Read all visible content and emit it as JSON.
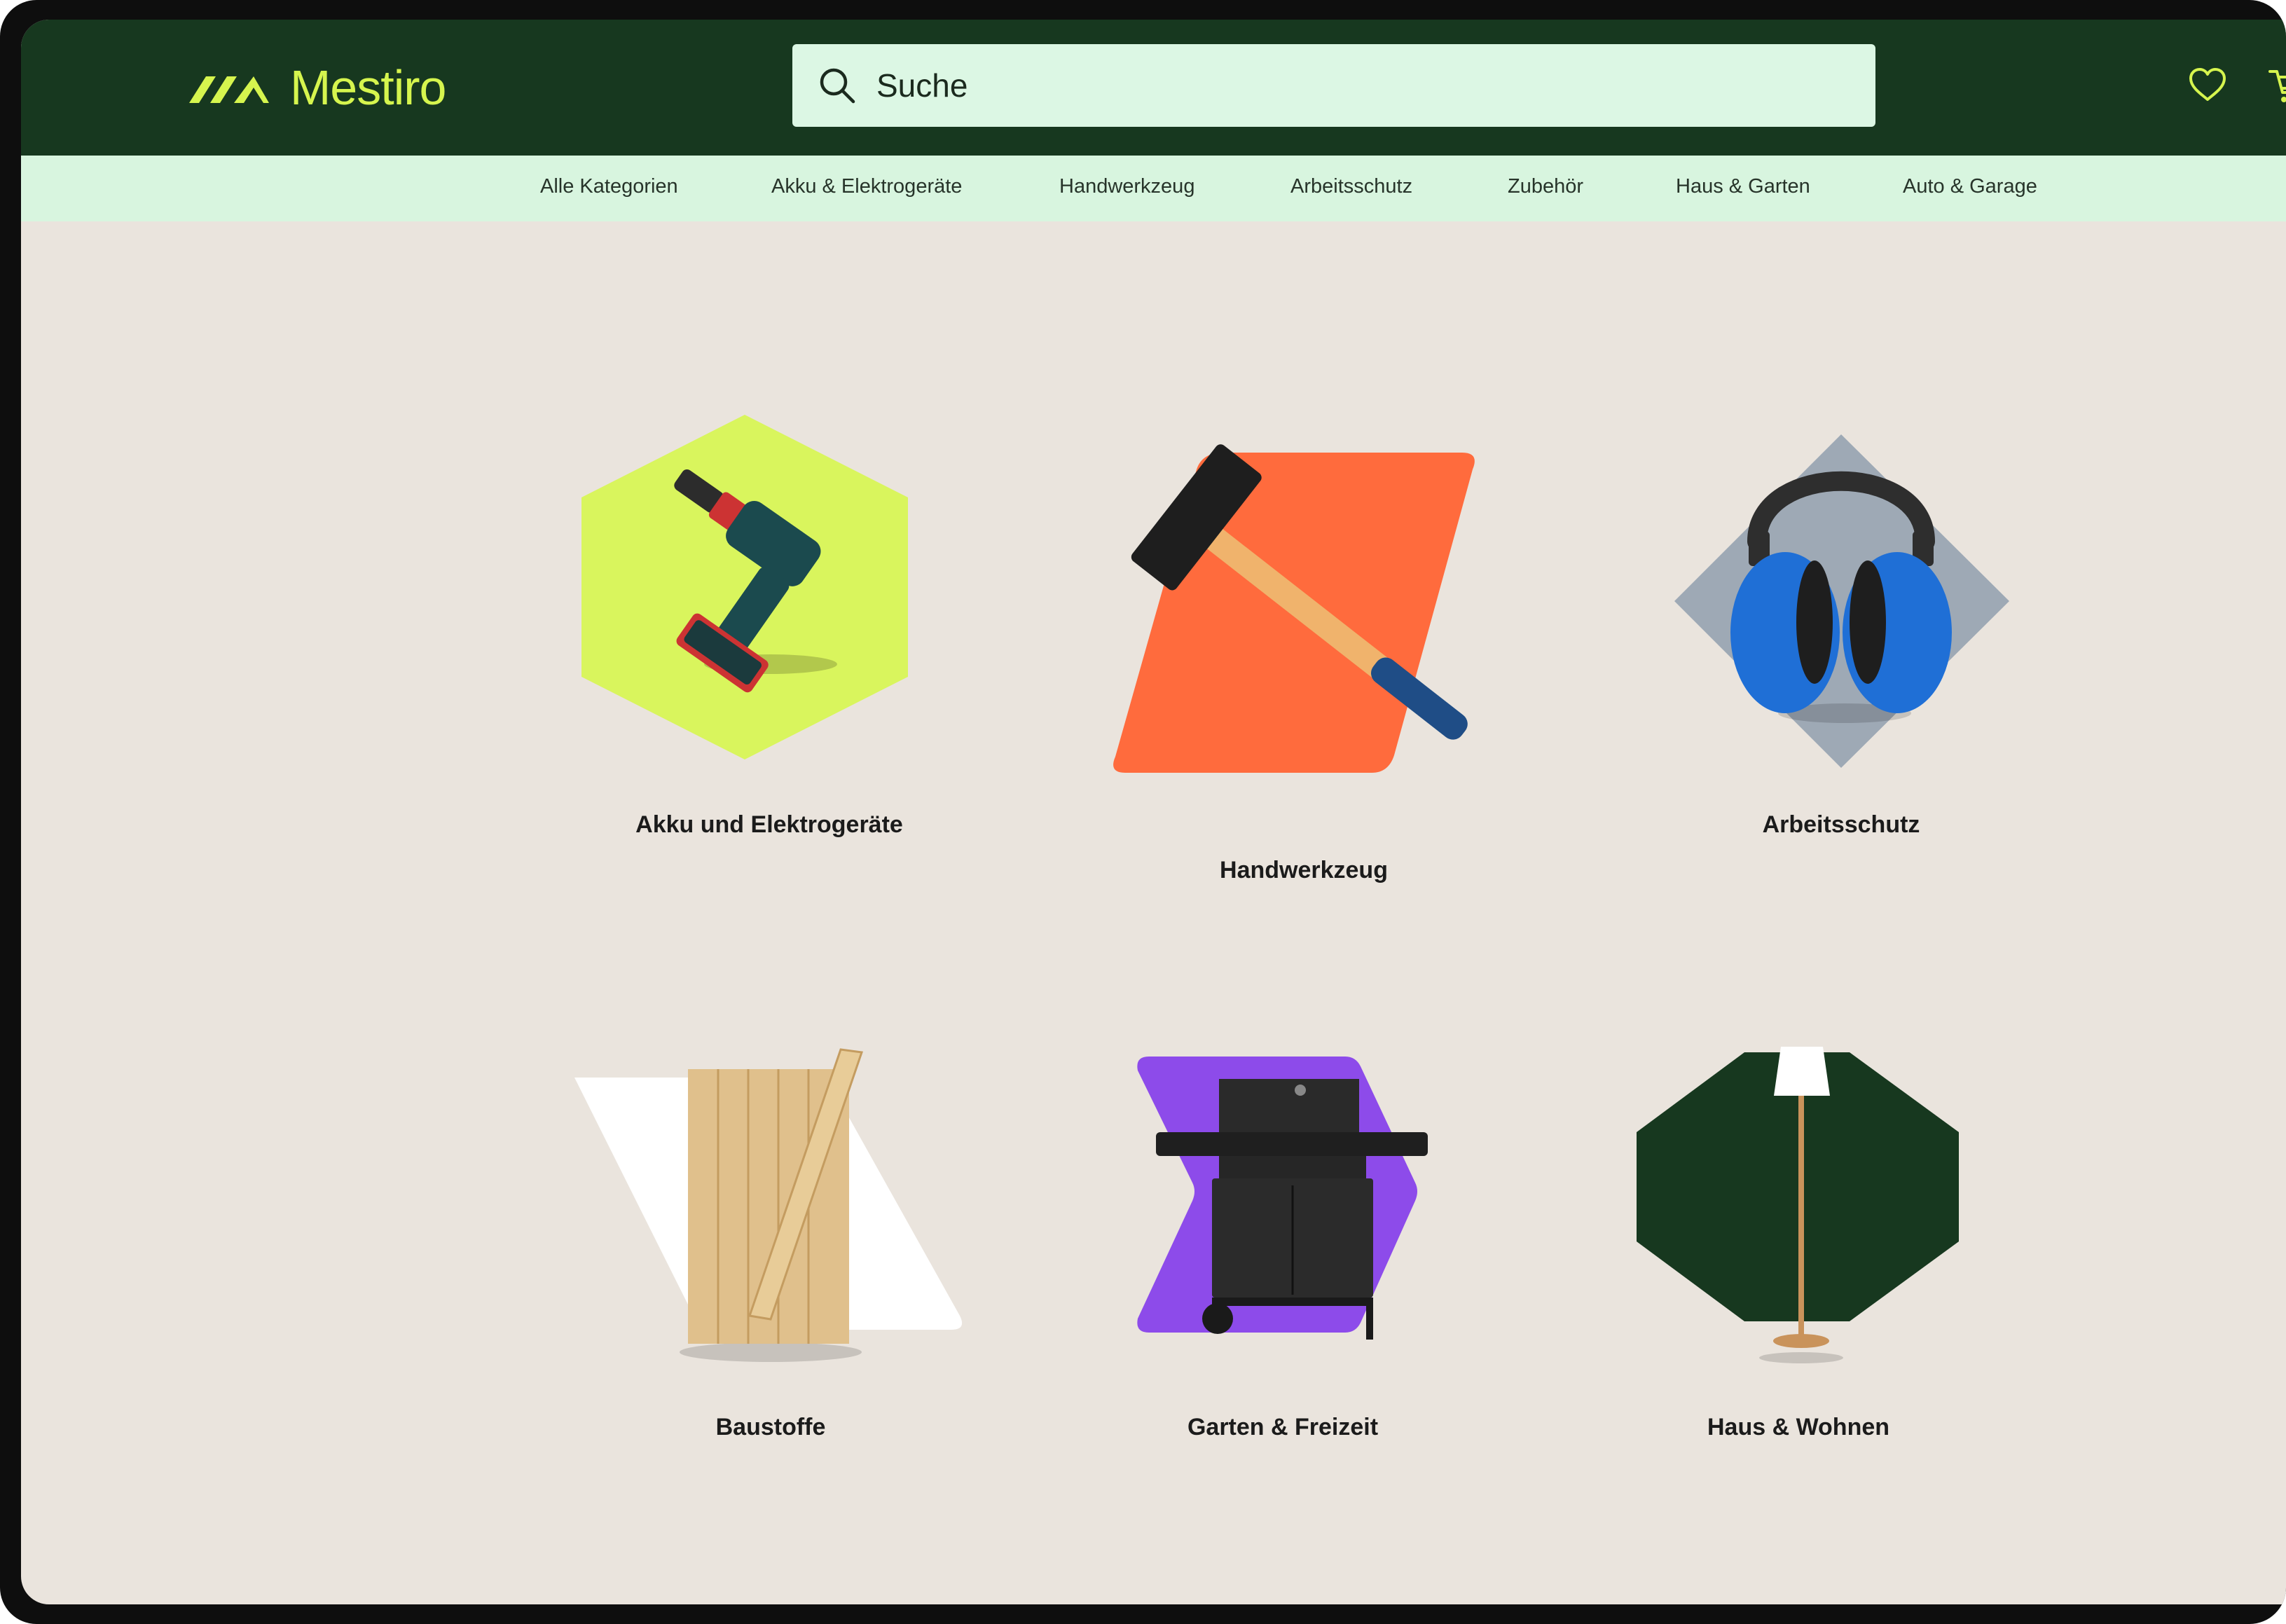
{
  "brand": {
    "name": "Mestiro",
    "accent_color": "#d6f54e",
    "header_color": "#17381f"
  },
  "search": {
    "placeholder": "Suche",
    "icon": "search-icon"
  },
  "header_icons": [
    {
      "name": "heart-icon"
    },
    {
      "name": "cart-icon"
    }
  ],
  "nav": {
    "items": [
      {
        "label": "Alle Kategorien"
      },
      {
        "label": "Akku & Elektrogeräte"
      },
      {
        "label": "Handwerkzeug"
      },
      {
        "label": "Arbeitsschutz"
      },
      {
        "label": "Zubehör"
      },
      {
        "label": "Haus & Garten"
      },
      {
        "label": "Auto & Garage"
      }
    ]
  },
  "categories": [
    {
      "label": "Akku und Elektrogeräte",
      "image": "drill",
      "shape": "hexagon",
      "color": "#d9f55d"
    },
    {
      "label": "Handwerkzeug",
      "image": "hammer",
      "shape": "parallelogram",
      "color": "#ff6b3d"
    },
    {
      "label": "Arbeitsschutz",
      "image": "ear-protection",
      "shape": "diamond",
      "color": "#9ea9b5"
    },
    {
      "label": "Baustoffe",
      "image": "wood-boards",
      "shape": "parallelogram",
      "color": "#ffffff"
    },
    {
      "label": "Garten & Freizeit",
      "image": "grill",
      "shape": "chevron",
      "color": "#8d4bea"
    },
    {
      "label": "Haus & Wohnen",
      "image": "floor-lamp",
      "shape": "octagon",
      "color": "#17381f"
    }
  ]
}
